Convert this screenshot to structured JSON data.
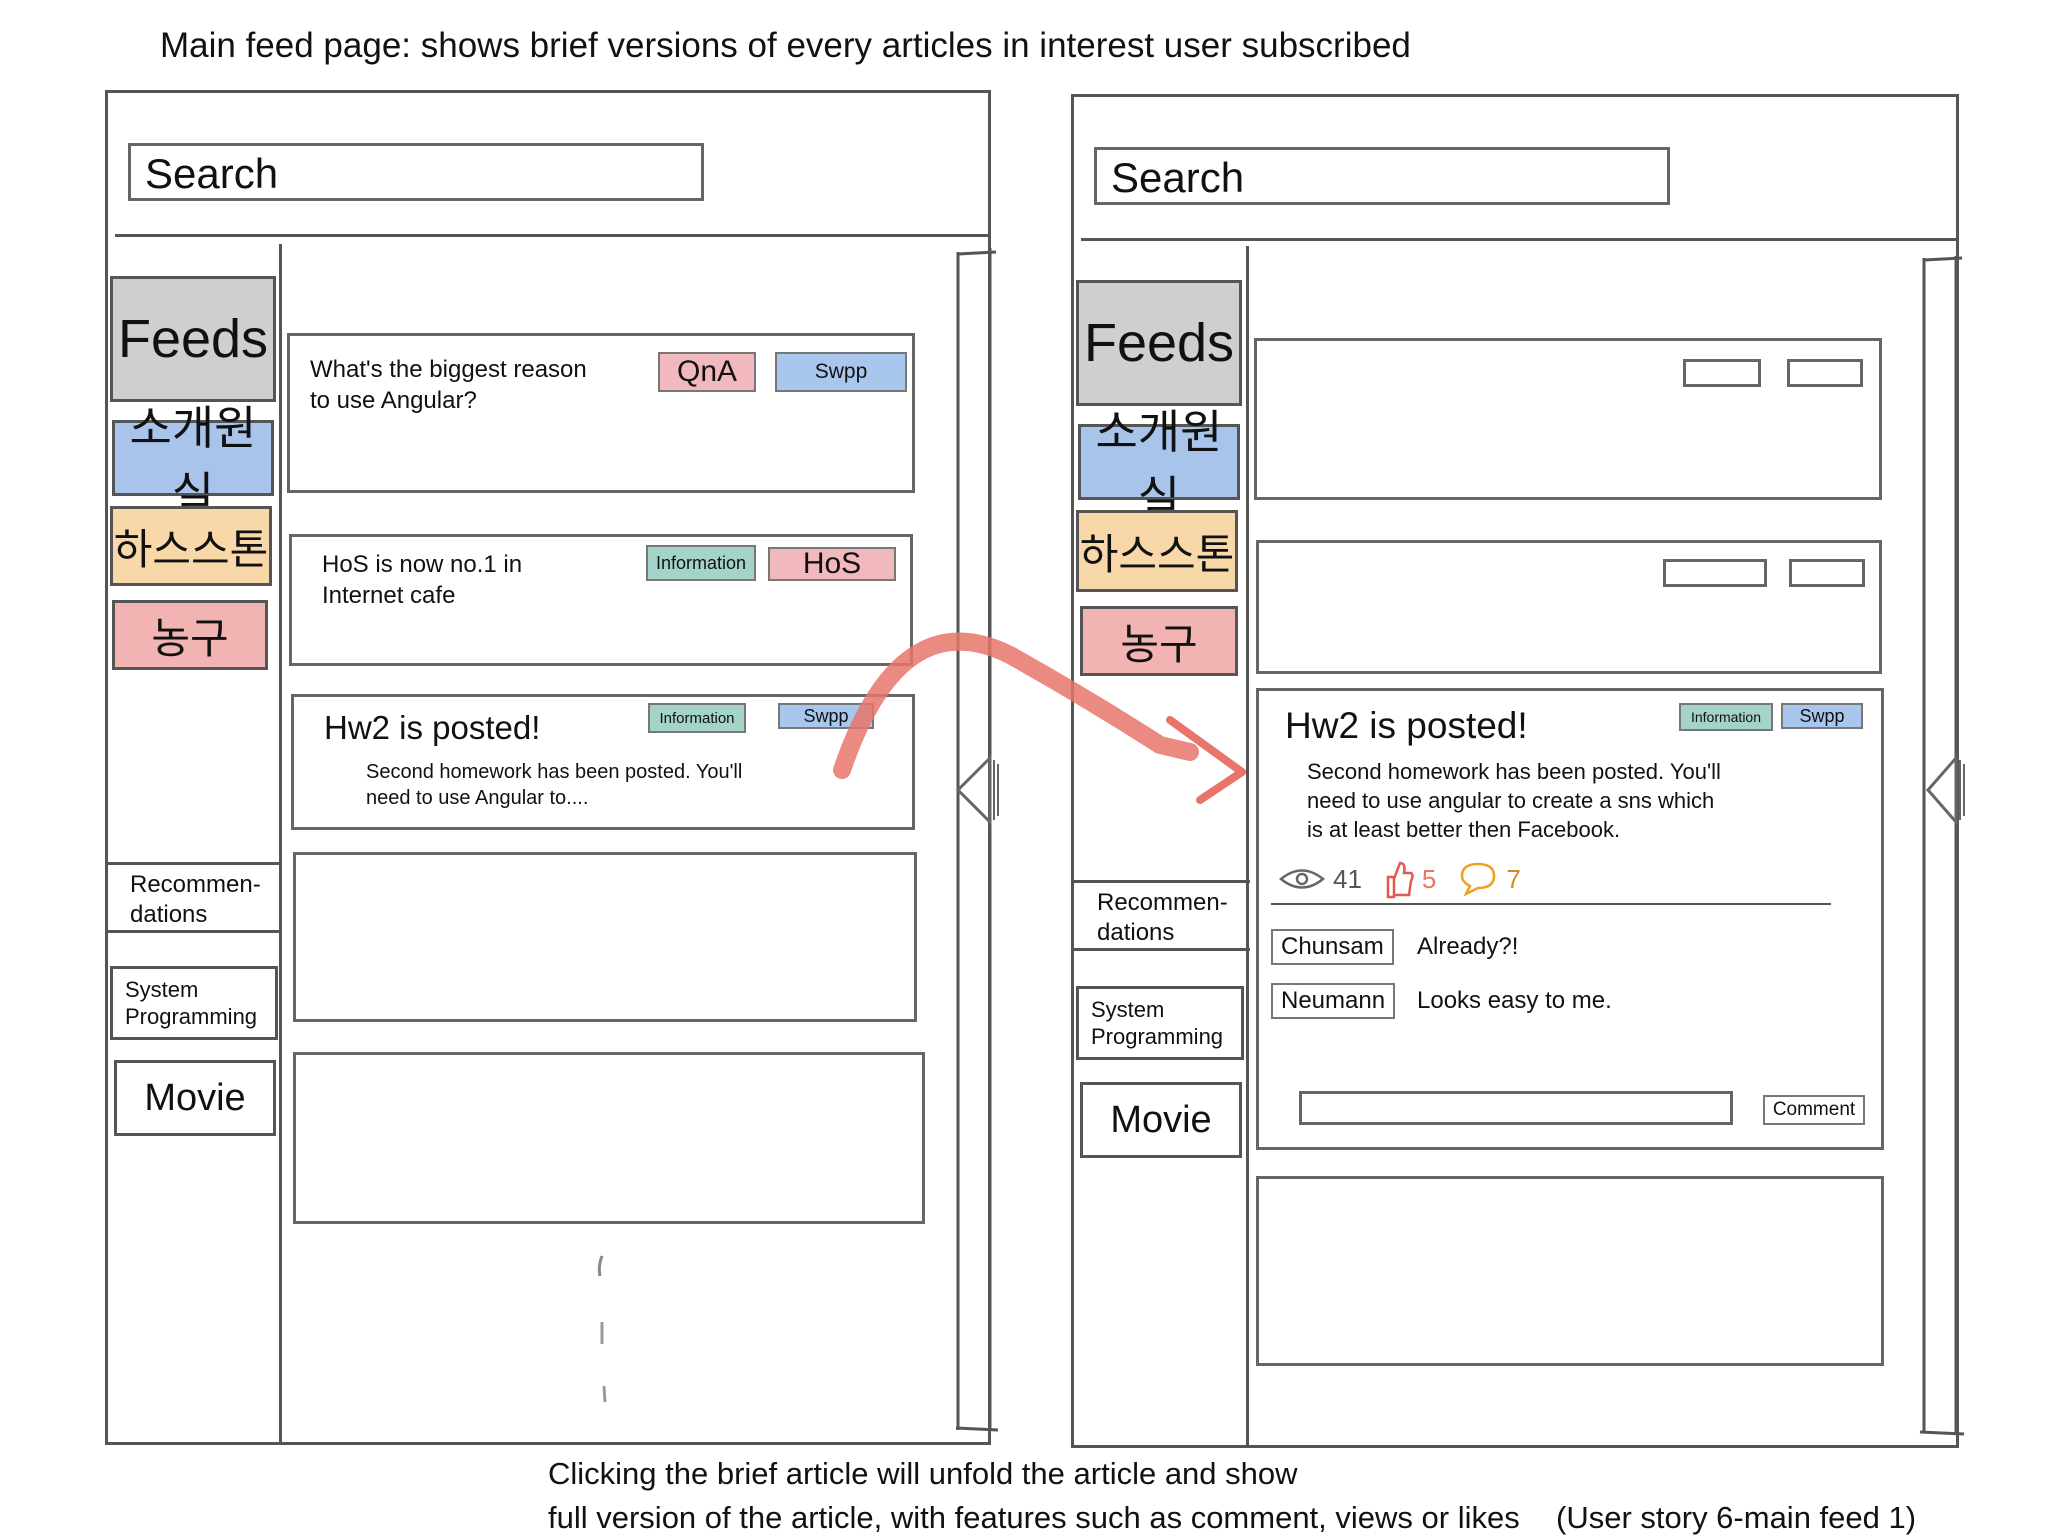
{
  "caption_top": "Main feed page: shows brief versions of every articles in interest user subscribed",
  "caption_bottom_line1": "Clicking the brief article will unfold the article and show",
  "caption_bottom_line2": "full version of the article, with features such as comment, views or likes",
  "caption_story": "(User story 6-main feed 1)",
  "search": {
    "placeholder": "Search"
  },
  "sidebar": {
    "feeds": "Feeds",
    "items": [
      "소개원실",
      "하스스톤",
      "농구"
    ],
    "recommendations": "Recommen-\ndations",
    "rec_items": [
      "System\nProgramming",
      "Movie"
    ]
  },
  "left_feed": {
    "cards": [
      {
        "title": "What's the biggest reason\nto use Angular?",
        "tags": [
          "QnA",
          "Swpp"
        ]
      },
      {
        "title": "HoS is now no.1 in\nInternet cafe",
        "tags": [
          "Information",
          "HoS"
        ]
      },
      {
        "title": "Hw2 is posted!",
        "body": "Second homework has been posted. You'll\nneed to use Angular to....",
        "tags": [
          "Information",
          "Swpp"
        ]
      }
    ]
  },
  "right_feed": {
    "expanded": {
      "title": "Hw2 is posted!",
      "body": "Second homework has been posted. You'll\nneed to use angular to create a sns which\nis at least better then Facebook.",
      "tags": [
        "Information",
        "Swpp"
      ],
      "views": "41",
      "likes": "5",
      "comments_count": "7",
      "comments": [
        {
          "user": "Chunsam",
          "text": "Already?!"
        },
        {
          "user": "Neumann",
          "text": "Looks easy to me."
        }
      ],
      "comment_button": "Comment"
    }
  },
  "colors": {
    "tag_red": "#f1b9bd",
    "tag_blue": "#a9c6ec",
    "tag_teal": "#a3d3c9",
    "arrow": "#e8756a"
  }
}
